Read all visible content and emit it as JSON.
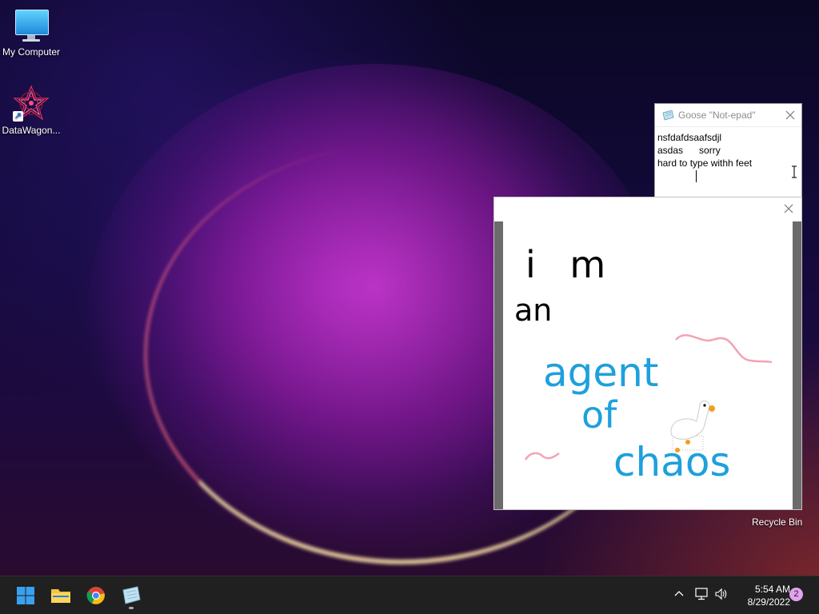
{
  "desktop": {
    "icons": [
      {
        "label": "My Computer"
      },
      {
        "label": "DataWagon..."
      },
      {
        "label": "Recycle Bin"
      }
    ]
  },
  "notepad": {
    "title": "Goose \"Not-epad\"",
    "lines": [
      "nsfdafdsaafsdjl",
      "asdas      sorry",
      "hard to type withh feet"
    ]
  },
  "drawing": {
    "texts": [
      "i m",
      "an",
      "agent",
      "of",
      "chaos"
    ],
    "colors": {
      "black": "#000000",
      "blue": "#1ea0dc",
      "pink": "#f2a3b4"
    }
  },
  "taskbar": {
    "time": "5:54 AM",
    "date": "8/29/2022",
    "notifications": "2",
    "apps": [
      "start-icon",
      "file-explorer-icon",
      "chrome-icon",
      "notepad-icon"
    ]
  }
}
